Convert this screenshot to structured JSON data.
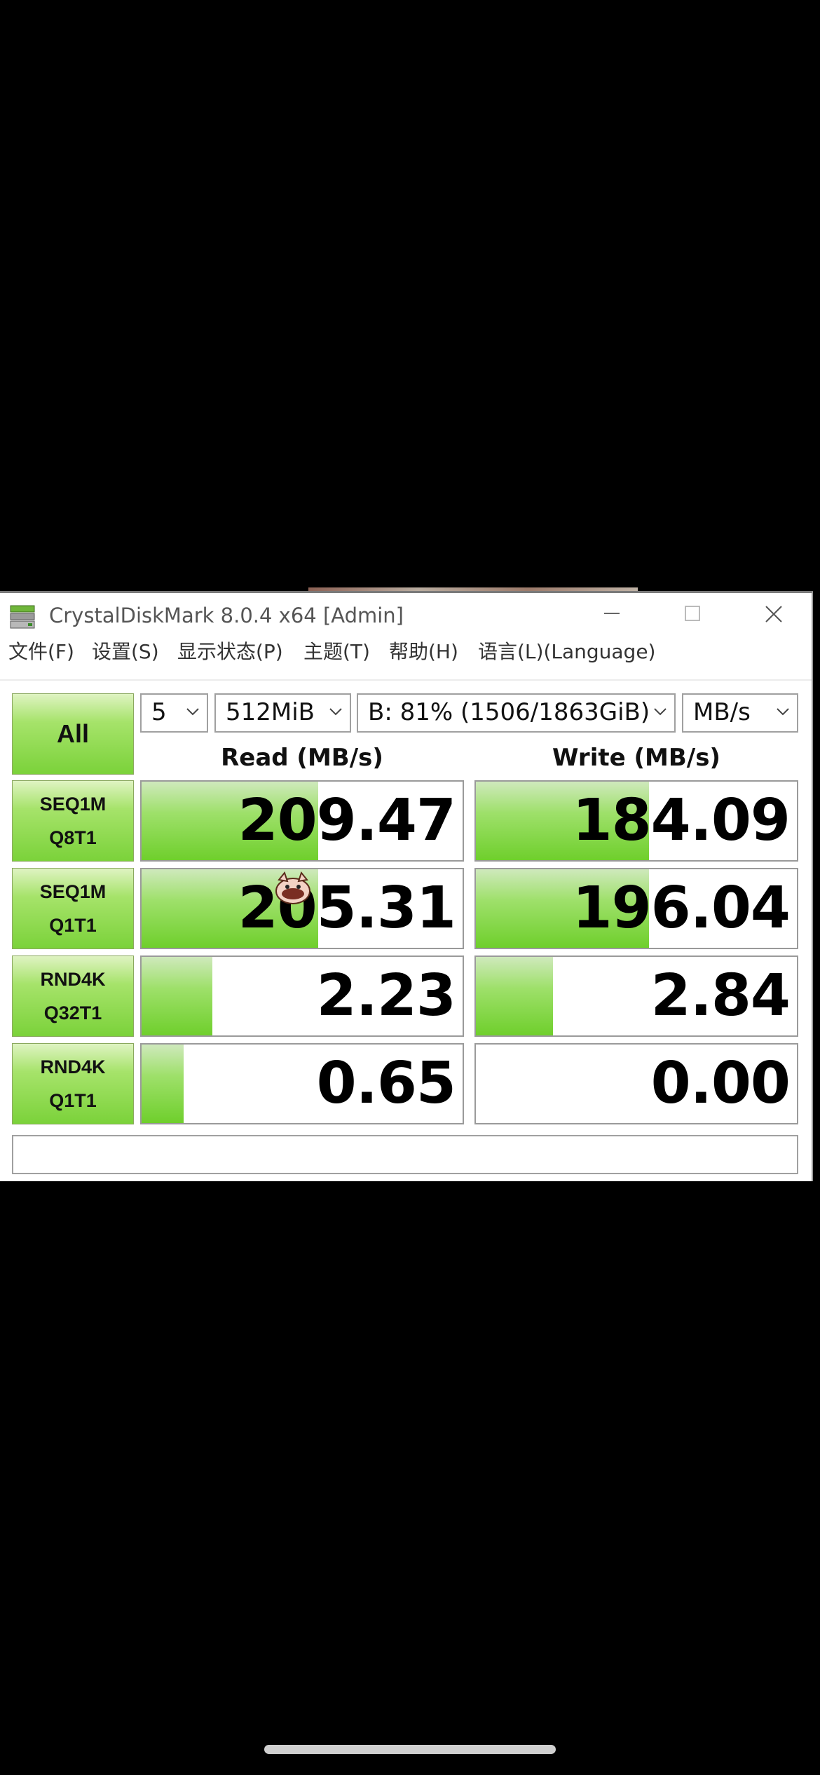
{
  "window": {
    "title": "CrystalDiskMark 8.0.4 x64 [Admin]",
    "icon": "drive-icon"
  },
  "menu": [
    {
      "label": "文件(F)"
    },
    {
      "label": "设置(S)"
    },
    {
      "label": "显示状态(P)"
    },
    {
      "label": "主题(T)"
    },
    {
      "label": "帮助(H)"
    },
    {
      "label": "语言(L)(Language)"
    }
  ],
  "controls": {
    "all_label": "All",
    "count": "5",
    "size": "512MiB",
    "drive": "B: 81% (1506/1863GiB)",
    "unit": "MB/s"
  },
  "headers": {
    "read": "Read (MB/s)",
    "write": "Write (MB/s)"
  },
  "tests": [
    {
      "line1": "SEQ1M",
      "line2": "Q8T1",
      "read": "209.47",
      "write": "184.09",
      "read_fill": 0.55,
      "write_fill": 0.54
    },
    {
      "line1": "SEQ1M",
      "line2": "Q1T1",
      "read": "205.31",
      "write": "196.04",
      "read_fill": 0.55,
      "write_fill": 0.54
    },
    {
      "line1": "RND4K",
      "line2": "Q32T1",
      "read": "2.23",
      "write": "2.84",
      "read_fill": 0.22,
      "write_fill": 0.24
    },
    {
      "line1": "RND4K",
      "line2": "Q1T1",
      "read": "0.65",
      "write": "0.00",
      "read_fill": 0.13,
      "write_fill": 0.0
    }
  ],
  "comment": "",
  "colors": {
    "bar_green": "#7bd23a",
    "border": "#9a9a9a"
  }
}
